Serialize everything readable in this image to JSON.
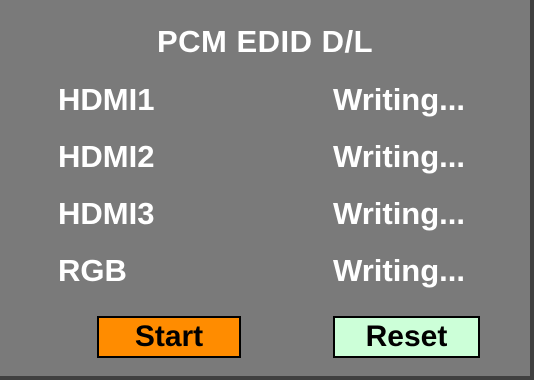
{
  "panel": {
    "title": "PCM EDID D/L"
  },
  "rows": [
    {
      "label": "HDMI1",
      "status": "Writing..."
    },
    {
      "label": "HDMI2",
      "status": "Writing..."
    },
    {
      "label": "HDMI3",
      "status": "Writing..."
    },
    {
      "label": "RGB",
      "status": "Writing..."
    }
  ],
  "buttons": {
    "start_label": "Start",
    "reset_label": "Reset"
  },
  "colors": {
    "panel_bg": "#7a7a7a",
    "start_bg": "#ff8c00",
    "reset_bg": "#ccffd8",
    "text": "#ffffff"
  }
}
